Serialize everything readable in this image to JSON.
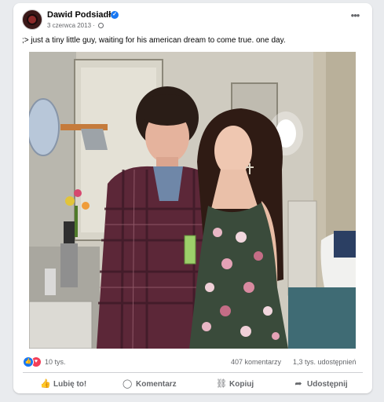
{
  "post": {
    "author": "Dawid Podsiadło",
    "date": "3 czerwca 2013",
    "date_separator": "·",
    "caption": ";> just a tiny little guy, waiting for his american dream to come true. one day.",
    "more_label": "•••"
  },
  "stats": {
    "reactions_count": "10 tys.",
    "comments": "407 komentarzy",
    "shares": "1,3 tys. udostępnień"
  },
  "actions": {
    "like": "Lubię to!",
    "comment": "Komentarz",
    "copy": "Kopiuj",
    "share": "Udostępnij"
  },
  "icons": {
    "like": "thumbs-up-icon",
    "comment": "speech-bubble-icon",
    "copy": "link-icon",
    "share": "share-arrow-icon",
    "verified": "verified-badge-icon",
    "audience": "globe-icon"
  },
  "colors": {
    "like_blue": "#1877f2",
    "love_red": "#f33e58",
    "secondary_text": "#65676b"
  }
}
